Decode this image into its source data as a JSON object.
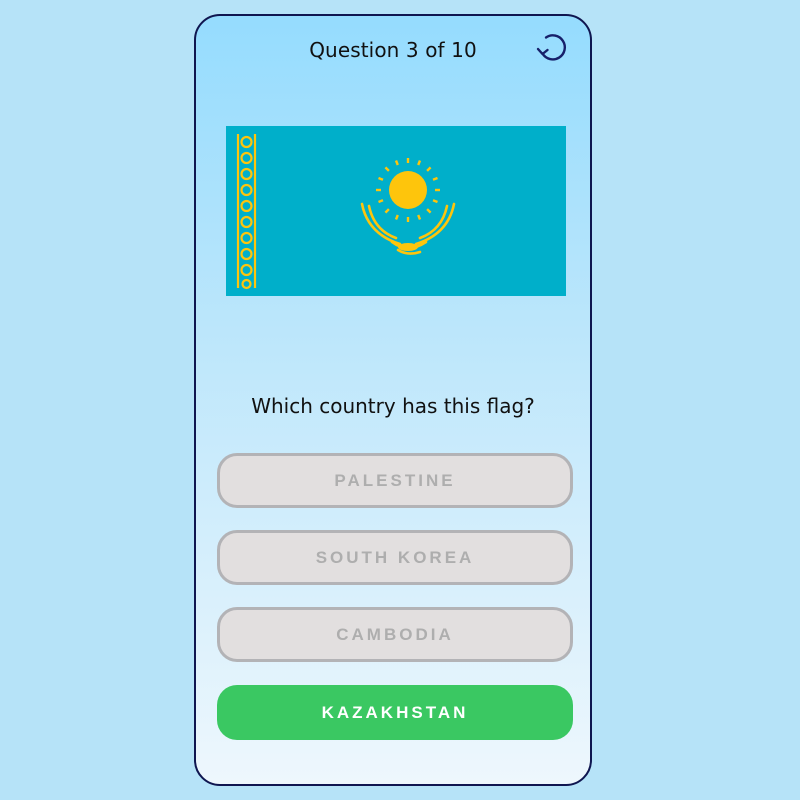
{
  "quiz": {
    "progress_label": "Question 3 of 10",
    "current_question": 3,
    "total_questions": 10,
    "question_text": "Which country has this flag?",
    "restart_icon": "restart-icon",
    "flag": {
      "country": "Kazakhstan",
      "colors": {
        "background": "#00afca",
        "emblem": "#fec50c"
      }
    },
    "options": [
      {
        "label": "PALESTINE",
        "state": "disabled"
      },
      {
        "label": "SOUTH KOREA",
        "state": "disabled"
      },
      {
        "label": "CAMBODIA",
        "state": "disabled"
      },
      {
        "label": "KAZAKHSTAN",
        "state": "correct"
      }
    ]
  },
  "colors": {
    "page_background": "#b6e3f8",
    "card_border": "#0f1650",
    "correct_green": "#3ac862",
    "disabled_fill": "#e2dfdf",
    "disabled_text": "#aeaeae"
  }
}
